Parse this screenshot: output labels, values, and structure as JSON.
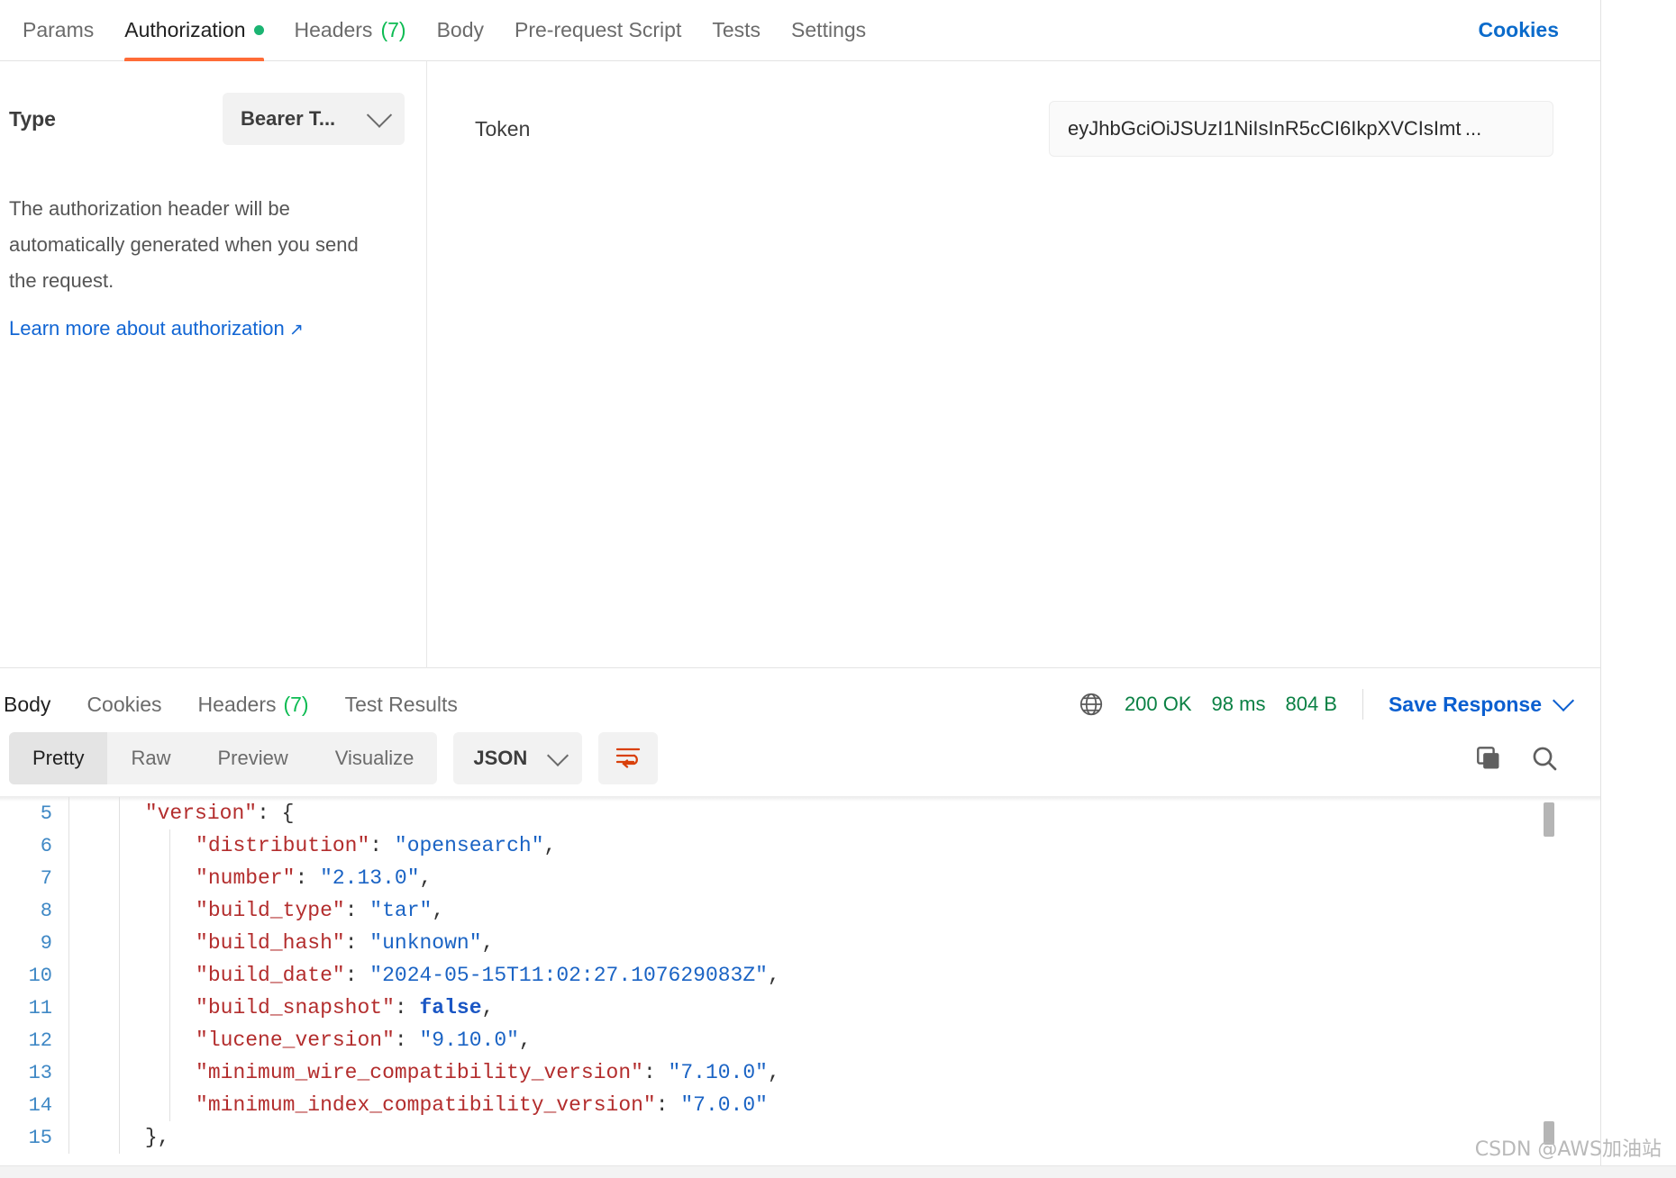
{
  "request_tabs": {
    "items": [
      {
        "label": "Params",
        "active": false,
        "dot": false,
        "count": ""
      },
      {
        "label": "Authorization",
        "active": true,
        "dot": true,
        "count": ""
      },
      {
        "label": "Headers",
        "active": false,
        "dot": false,
        "count": "(7)"
      },
      {
        "label": "Body",
        "active": false,
        "dot": false,
        "count": ""
      },
      {
        "label": "Pre-request Script",
        "active": false,
        "dot": false,
        "count": ""
      },
      {
        "label": "Tests",
        "active": false,
        "dot": false,
        "count": ""
      },
      {
        "label": "Settings",
        "active": false,
        "dot": false,
        "count": ""
      }
    ],
    "cookies_label": "Cookies"
  },
  "auth": {
    "type_label": "Type",
    "type_value": "Bearer T...",
    "type_icon": "chevron-down-icon",
    "description": "The authorization header will be automatically generated when you send the request.",
    "learn_more": "Learn more about authorization",
    "learn_more_icon": "external-link-arrow-icon",
    "token_label": "Token",
    "token_value": "eyJhbGciOiJSUzI1NiIsInR5cCI6IkpXVCIsImt ...",
    "token_placeholder": "Token"
  },
  "response": {
    "tabs": [
      {
        "label": "Body",
        "active": true,
        "count": ""
      },
      {
        "label": "Cookies",
        "active": false,
        "count": ""
      },
      {
        "label": "Headers",
        "active": false,
        "count": "(7)"
      },
      {
        "label": "Test Results",
        "active": false,
        "count": ""
      }
    ],
    "network_icon": "globe-icon",
    "status": "200 OK",
    "time": "98 ms",
    "size": "804 B",
    "save_label": "Save Response",
    "save_icon": "chevron-down-icon"
  },
  "body_toolbar": {
    "views": [
      {
        "label": "Pretty",
        "active": true
      },
      {
        "label": "Raw",
        "active": false
      },
      {
        "label": "Preview",
        "active": false
      },
      {
        "label": "Visualize",
        "active": false
      }
    ],
    "format": "JSON",
    "format_icon": "chevron-down-icon",
    "wrap_icon": "word-wrap-icon",
    "copy_icon": "copy-icon",
    "search_icon": "search-icon"
  },
  "code": {
    "language": "json",
    "lines": [
      {
        "n": "5",
        "indent": 1,
        "tokens": [
          {
            "t": "\"version\"",
            "c": "k"
          },
          {
            "t": ": ",
            "c": "p"
          },
          {
            "t": "{",
            "c": "p"
          }
        ]
      },
      {
        "n": "6",
        "indent": 2,
        "tokens": [
          {
            "t": "\"distribution\"",
            "c": "k"
          },
          {
            "t": ": ",
            "c": "p"
          },
          {
            "t": "\"opensearch\"",
            "c": "s"
          },
          {
            "t": ",",
            "c": "p"
          }
        ]
      },
      {
        "n": "7",
        "indent": 2,
        "tokens": [
          {
            "t": "\"number\"",
            "c": "k"
          },
          {
            "t": ": ",
            "c": "p"
          },
          {
            "t": "\"2.13.0\"",
            "c": "s"
          },
          {
            "t": ",",
            "c": "p"
          }
        ]
      },
      {
        "n": "8",
        "indent": 2,
        "tokens": [
          {
            "t": "\"build_type\"",
            "c": "k"
          },
          {
            "t": ": ",
            "c": "p"
          },
          {
            "t": "\"tar\"",
            "c": "s"
          },
          {
            "t": ",",
            "c": "p"
          }
        ]
      },
      {
        "n": "9",
        "indent": 2,
        "tokens": [
          {
            "t": "\"build_hash\"",
            "c": "k"
          },
          {
            "t": ": ",
            "c": "p"
          },
          {
            "t": "\"unknown\"",
            "c": "s"
          },
          {
            "t": ",",
            "c": "p"
          }
        ]
      },
      {
        "n": "10",
        "indent": 2,
        "tokens": [
          {
            "t": "\"build_date\"",
            "c": "k"
          },
          {
            "t": ": ",
            "c": "p"
          },
          {
            "t": "\"2024-05-15T11:02:27.107629083Z\"",
            "c": "s"
          },
          {
            "t": ",",
            "c": "p"
          }
        ]
      },
      {
        "n": "11",
        "indent": 2,
        "tokens": [
          {
            "t": "\"build_snapshot\"",
            "c": "k"
          },
          {
            "t": ": ",
            "c": "p"
          },
          {
            "t": "false",
            "c": "b"
          },
          {
            "t": ",",
            "c": "p"
          }
        ]
      },
      {
        "n": "12",
        "indent": 2,
        "tokens": [
          {
            "t": "\"lucene_version\"",
            "c": "k"
          },
          {
            "t": ": ",
            "c": "p"
          },
          {
            "t": "\"9.10.0\"",
            "c": "s"
          },
          {
            "t": ",",
            "c": "p"
          }
        ]
      },
      {
        "n": "13",
        "indent": 2,
        "tokens": [
          {
            "t": "\"minimum_wire_compatibility_version\"",
            "c": "k"
          },
          {
            "t": ": ",
            "c": "p"
          },
          {
            "t": "\"7.10.0\"",
            "c": "s"
          },
          {
            "t": ",",
            "c": "p"
          }
        ]
      },
      {
        "n": "14",
        "indent": 2,
        "tokens": [
          {
            "t": "\"minimum_index_compatibility_version\"",
            "c": "k"
          },
          {
            "t": ": ",
            "c": "p"
          },
          {
            "t": "\"7.0.0\"",
            "c": "s"
          }
        ]
      },
      {
        "n": "15",
        "indent": 1,
        "tokens": [
          {
            "t": "},",
            "c": "p"
          }
        ]
      }
    ]
  },
  "watermark": "CSDN @AWS加油站",
  "colors": {
    "accent_orange": "#ff6c37",
    "link_blue": "#0b6bcb",
    "status_green": "#0a8043",
    "dot_green": "#1bb472",
    "json_key": "#b32d2d",
    "json_string": "#1a63c4",
    "line_number": "#3f88c5"
  }
}
